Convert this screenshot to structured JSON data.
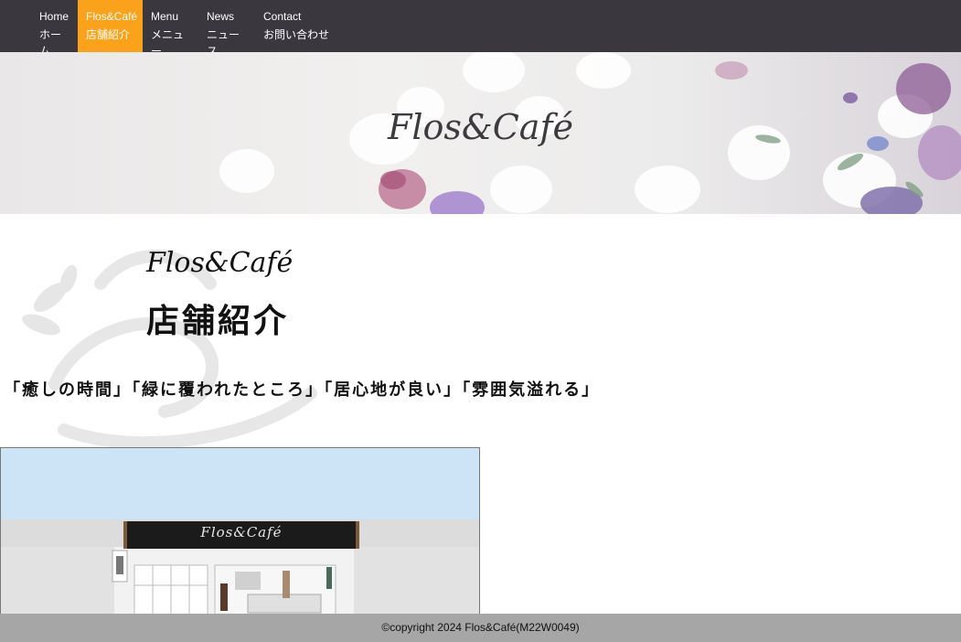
{
  "nav": {
    "items": [
      {
        "en": "Home",
        "jp": "ホーム",
        "active": false
      },
      {
        "en": "Flos&Café",
        "jp": "店舗紹介",
        "active": true
      },
      {
        "en": "Menu",
        "jp": "メニュー",
        "active": false
      },
      {
        "en": "News",
        "jp": "ニュース",
        "active": false
      },
      {
        "en": "Contact",
        "jp": "お問い合わせ",
        "active": false
      }
    ],
    "active_color": "#fba21b",
    "bar_color": "#3a383e"
  },
  "hero": {
    "logo": "Flos&Café"
  },
  "section": {
    "logo": "Flos&Café",
    "title": "店舗紹介",
    "tagline": "「癒しの時間」「緑に覆われたところ」「居心地が良い」「雰囲気溢れる」"
  },
  "store_image": {
    "sign": "Flos&Café"
  },
  "footer": {
    "copyright": "©copyright 2024 Flos&Café(M22W0049)"
  }
}
